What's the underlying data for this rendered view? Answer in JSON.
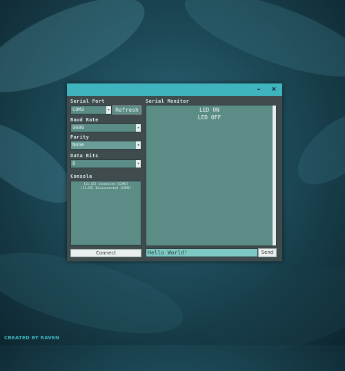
{
  "window": {
    "minimize_label": "–",
    "close_label": "×"
  },
  "left_panel": {
    "serial_port": {
      "label": "Serial Port",
      "value": "COM3",
      "refresh_label": "Refresh"
    },
    "baud_rate": {
      "label": "Baud Rate",
      "value": "9600"
    },
    "parity": {
      "label": "Parity",
      "value": "None"
    },
    "data_bits": {
      "label": "Data Bits",
      "value": "8"
    },
    "console": {
      "label": "Console",
      "lines": [
        "[11:55] Connected [COM3]",
        "[11:55] Disconnected [COM3]"
      ]
    },
    "connect_label": "Connect"
  },
  "right_panel": {
    "label": "Serial Monitor",
    "lines": [
      "LED ON",
      "LED OFF"
    ],
    "send_input_value": "Hello World!",
    "send_label": "Send"
  },
  "credit": "CREATED BY RAVEN",
  "colors": {
    "titlebar": "#3fb4be",
    "window_bg": "#3f4b4d",
    "field_bg": "#5b8c86",
    "send_input_bg": "#7fc9c4"
  },
  "icons": {
    "dropdown": "chevron-down-icon",
    "minimize": "minimize-icon",
    "close": "close-icon"
  }
}
